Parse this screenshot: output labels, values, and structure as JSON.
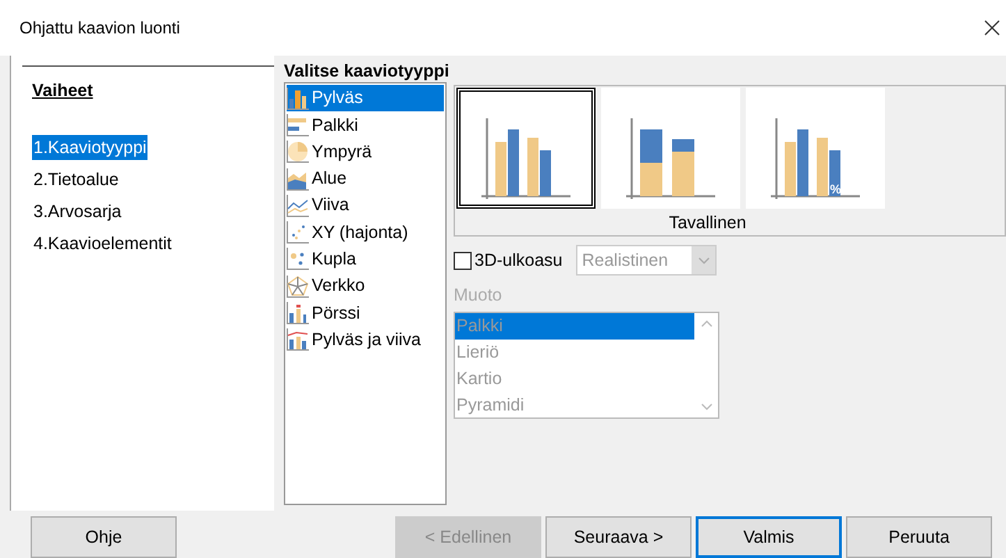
{
  "window": {
    "title": "Ohjattu kaavion luonti"
  },
  "steps": {
    "heading": "Vaiheet",
    "items": [
      {
        "label": "1.Kaaviotyyppi",
        "selected": true
      },
      {
        "label": "2.Tietoalue",
        "selected": false
      },
      {
        "label": "3.Arvosarja",
        "selected": false
      },
      {
        "label": "4.Kaavioelementit",
        "selected": false
      }
    ]
  },
  "chart_type": {
    "heading": "Valitse kaaviotyyppi",
    "types": [
      {
        "label": "Pylväs",
        "kind": "column",
        "selected": true
      },
      {
        "label": "Palkki",
        "kind": "bar",
        "selected": false
      },
      {
        "label": "Ympyrä",
        "kind": "pie",
        "selected": false
      },
      {
        "label": "Alue",
        "kind": "area",
        "selected": false
      },
      {
        "label": "Viiva",
        "kind": "line",
        "selected": false
      },
      {
        "label": "XY (hajonta)",
        "kind": "scatter",
        "selected": false
      },
      {
        "label": "Kupla",
        "kind": "bubble",
        "selected": false
      },
      {
        "label": "Verkko",
        "kind": "net",
        "selected": false
      },
      {
        "label": "Pörssi",
        "kind": "stock",
        "selected": false
      },
      {
        "label": "Pylväs ja viiva",
        "kind": "columnline",
        "selected": false
      }
    ],
    "variants": [
      {
        "kind": "normal",
        "selected": true
      },
      {
        "kind": "stacked",
        "selected": false
      },
      {
        "kind": "percent",
        "selected": false,
        "mark": "%"
      }
    ],
    "variant_caption": "Tavallinen",
    "three_d": {
      "label": "3D-ulkoasu",
      "checked": false
    },
    "look": {
      "value": "Realistinen",
      "disabled": true
    },
    "shape": {
      "label": "Muoto",
      "disabled": true,
      "items": [
        {
          "label": "Palkki",
          "selected": true
        },
        {
          "label": "Lieriö",
          "selected": false
        },
        {
          "label": "Kartio",
          "selected": false
        },
        {
          "label": "Pyramidi",
          "selected": false
        }
      ]
    }
  },
  "buttons": [
    {
      "label": "Ohje",
      "disabled": false,
      "default": false
    },
    {
      "label": "< Edellinen",
      "disabled": true,
      "default": false
    },
    {
      "label": "Seuraava >",
      "disabled": false,
      "default": false
    },
    {
      "label": "Valmis",
      "disabled": false,
      "default": true
    },
    {
      "label": "Peruuta",
      "disabled": false,
      "default": false
    }
  ]
}
